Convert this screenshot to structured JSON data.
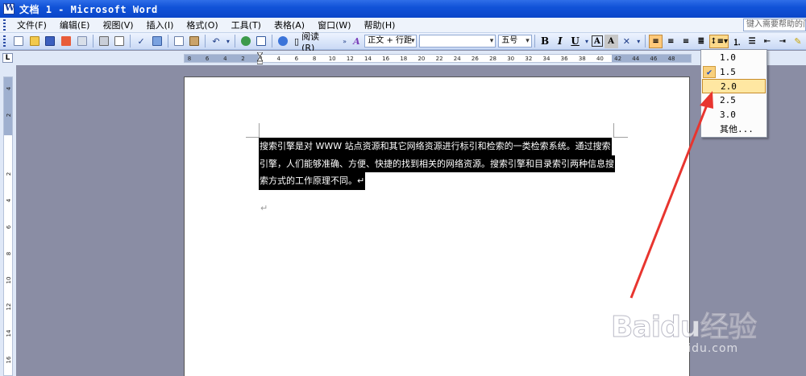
{
  "window": {
    "title": "文档 1 - Microsoft Word"
  },
  "menu": {
    "items": [
      {
        "label": "文件(F)"
      },
      {
        "label": "编辑(E)"
      },
      {
        "label": "视图(V)"
      },
      {
        "label": "插入(I)"
      },
      {
        "label": "格式(O)"
      },
      {
        "label": "工具(T)"
      },
      {
        "label": "表格(A)"
      },
      {
        "label": "窗口(W)"
      },
      {
        "label": "帮助(H)"
      }
    ],
    "help_placeholder": "键入需要帮助的问"
  },
  "toolbar": {
    "read_label": "阅读(R)",
    "style_combo": "正文 + 行距",
    "font_combo": "",
    "size_combo": "五号",
    "bold": "B",
    "italic": "I",
    "underline": "U"
  },
  "ruler": {
    "corner": "L",
    "h_labels": [
      "8",
      "6",
      "4",
      "2",
      "2",
      "4",
      "6",
      "8",
      "10",
      "12",
      "14",
      "16",
      "18",
      "20",
      "22",
      "24",
      "26",
      "28",
      "30",
      "32",
      "34",
      "36",
      "38",
      "40",
      "42",
      "44",
      "46",
      "48"
    ],
    "v_labels": [
      "4",
      "2",
      "2",
      "4",
      "6",
      "8",
      "10",
      "12",
      "14",
      "16"
    ]
  },
  "document": {
    "lines": [
      "搜索引擎是对 WWW 站点资源和其它网络资源进行标引和检索的一类检索系统。通过搜索",
      "引擎，人们能够准确、方便、快捷的找到相关的网络资源。搜索引擎和目录索引两种信息搜",
      "索方式的工作原理不同。↵"
    ],
    "empty_para_mark": "↵"
  },
  "line_spacing_menu": {
    "options": [
      {
        "label": "1.0",
        "checked": false,
        "hover": false
      },
      {
        "label": "1.5",
        "checked": true,
        "hover": false
      },
      {
        "label": "2.0",
        "checked": false,
        "hover": true
      },
      {
        "label": "2.5",
        "checked": false,
        "hover": false
      },
      {
        "label": "3.0",
        "checked": false,
        "hover": false
      },
      {
        "label": "其他...",
        "checked": false,
        "hover": false
      }
    ],
    "check_glyph": "✔"
  },
  "watermark": {
    "main": "Baidu经验",
    "sub": "jingyan.baidu.com"
  },
  "colors": {
    "accent": "#e8352f",
    "selection": "#000000",
    "hover": "#ffe7a2"
  }
}
